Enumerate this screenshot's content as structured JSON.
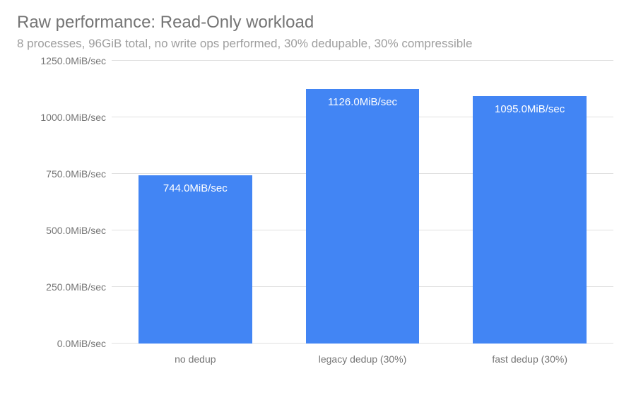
{
  "title": "Raw performance: Read-Only workload",
  "subtitle": "8 processes, 96GiB total, no write ops performed, 30% dedupable, 30% compressible",
  "chart_data": {
    "type": "bar",
    "categories": [
      "no dedup",
      "legacy dedup (30%)",
      "fast dedup (30%)"
    ],
    "values": [
      744.0,
      1126.0,
      1095.0
    ],
    "value_labels": [
      "744.0MiB/sec",
      "1126.0MiB/sec",
      "1095.0MiB/sec"
    ],
    "title": "Raw performance: Read-Only workload",
    "xlabel": "",
    "ylabel": "",
    "ylim": [
      0,
      1250
    ],
    "y_ticks": [
      0,
      250,
      500,
      750,
      1000,
      1250
    ],
    "y_tick_labels": [
      "0.0MiB/sec",
      "250.0MiB/sec",
      "500.0MiB/sec",
      "750.0MiB/sec",
      "1000.0MiB/sec",
      "1250.0MiB/sec"
    ],
    "bar_color": "#4285f4"
  }
}
